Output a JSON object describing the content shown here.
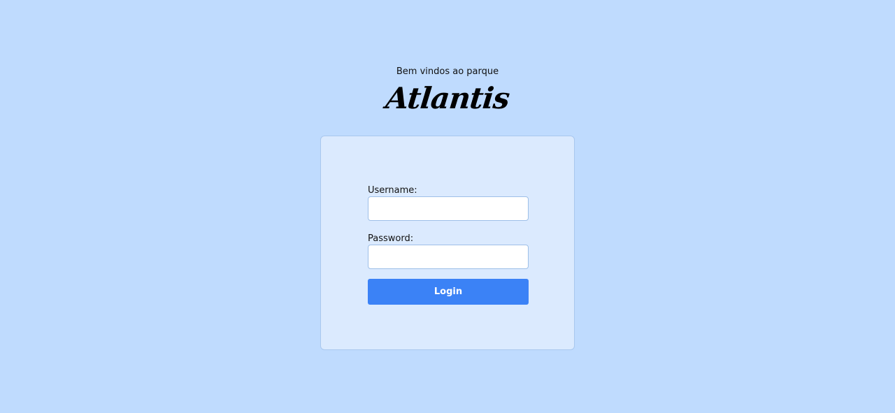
{
  "header": {
    "welcome_text": "Bem vindos ao parque",
    "logo_text": "Atlantis"
  },
  "login_form": {
    "username_label": "Username:",
    "username_value": "",
    "password_label": "Password:",
    "password_value": "",
    "login_label": "Login"
  },
  "colors": {
    "background": "#bfdbfe",
    "card_background": "#dbeafe",
    "button": "#3b82f6"
  }
}
